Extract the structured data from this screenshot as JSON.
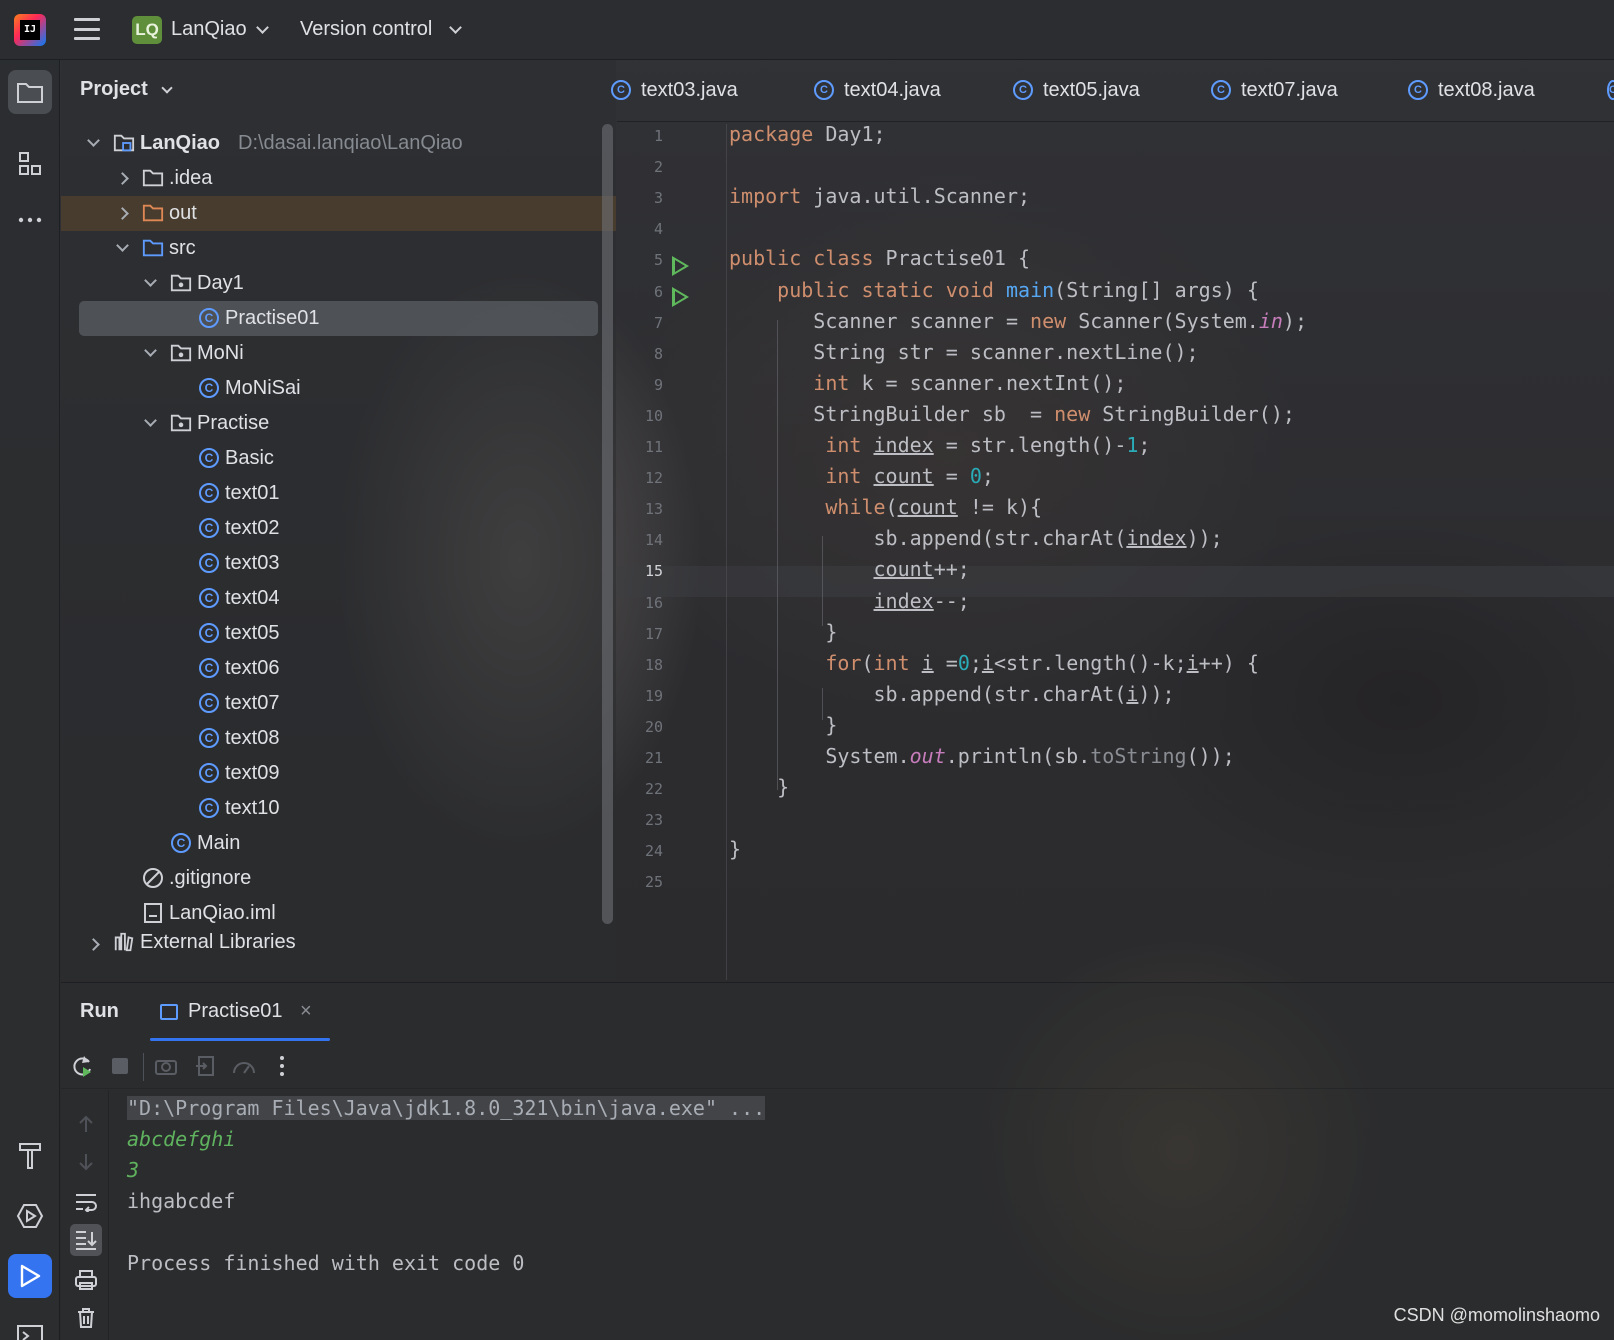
{
  "topbar": {
    "logo_text": "IJ",
    "project_badge": "LQ",
    "project_name": "LanQiao",
    "version_control": "Version control"
  },
  "project_panel": {
    "title": "Project",
    "tree": [
      {
        "label": "LanQiao",
        "path": "D:\\dasai.lanqiao\\LanQiao",
        "kind": "module",
        "depth": 0,
        "expanded": true
      },
      {
        "label": ".idea",
        "kind": "folder",
        "depth": 1,
        "expanded": false
      },
      {
        "label": "out",
        "kind": "folder-excluded",
        "depth": 1,
        "expanded": false
      },
      {
        "label": "src",
        "kind": "folder-source",
        "depth": 1,
        "expanded": true
      },
      {
        "label": "Day1",
        "kind": "package",
        "depth": 2,
        "expanded": true
      },
      {
        "label": "Practise01",
        "kind": "class",
        "depth": 3,
        "selected": true
      },
      {
        "label": "MoNi",
        "kind": "package",
        "depth": 2,
        "expanded": true
      },
      {
        "label": "MoNiSai",
        "kind": "class",
        "depth": 3
      },
      {
        "label": "Practise",
        "kind": "package",
        "depth": 2,
        "expanded": true
      },
      {
        "label": "Basic",
        "kind": "class",
        "depth": 3
      },
      {
        "label": "text01",
        "kind": "class",
        "depth": 3
      },
      {
        "label": "text02",
        "kind": "class",
        "depth": 3
      },
      {
        "label": "text03",
        "kind": "class",
        "depth": 3
      },
      {
        "label": "text04",
        "kind": "class",
        "depth": 3
      },
      {
        "label": "text05",
        "kind": "class",
        "depth": 3
      },
      {
        "label": "text06",
        "kind": "class",
        "depth": 3
      },
      {
        "label": "text07",
        "kind": "class",
        "depth": 3
      },
      {
        "label": "text08",
        "kind": "class",
        "depth": 3
      },
      {
        "label": "text09",
        "kind": "class",
        "depth": 3
      },
      {
        "label": "text10",
        "kind": "class",
        "depth": 3
      },
      {
        "label": "Main",
        "kind": "class",
        "depth": 2
      },
      {
        "label": ".gitignore",
        "kind": "ignore-file",
        "depth": 1
      },
      {
        "label": "LanQiao.iml",
        "kind": "iml-file",
        "depth": 1
      },
      {
        "label": "External Libraries",
        "kind": "libraries",
        "depth": 0,
        "expanded": false
      }
    ]
  },
  "editor": {
    "tabs": [
      "text03.java",
      "text04.java",
      "text05.java",
      "text07.java",
      "text08.java"
    ],
    "current_line": "15",
    "line_numbers": [
      "1",
      "2",
      "3",
      "4",
      "5",
      "6",
      "7",
      "8",
      "9",
      "10",
      "11",
      "12",
      "13",
      "14",
      "15",
      "16",
      "17",
      "18",
      "19",
      "20",
      "21",
      "22",
      "23",
      "24",
      "25"
    ],
    "code_lines": [
      "package Day1;",
      "",
      "import java.util.Scanner;",
      "",
      "public class Practise01 {",
      "    public static void main(String[] args) {",
      "       Scanner scanner = new Scanner(System.in);",
      "       String str = scanner.nextLine();",
      "       int k = scanner.nextInt();",
      "       StringBuilder sb  = new StringBuilder();",
      "        int index = str.length()-1;",
      "        int count = 0;",
      "        while(count != k){",
      "            sb.append(str.charAt(index));",
      "            count++;",
      "            index--;",
      "        }",
      "        for(int i =0;i<str.length()-k;i++) {",
      "            sb.append(str.charAt(i));",
      "        }",
      "        System.out.println(sb.toString());",
      "    }",
      "",
      "}",
      ""
    ]
  },
  "run_panel": {
    "title": "Run",
    "tab_label": "Practise01",
    "close_glyph": "×",
    "output": [
      {
        "text": "\"D:\\Program Files\\Java\\jdk1.8.0_321\\bin\\java.exe\" ...",
        "style": "cmd"
      },
      {
        "text": "abcdefghi",
        "style": "inp"
      },
      {
        "text": "3",
        "style": "inp"
      },
      {
        "text": "ihgabcdef",
        "style": "norm"
      },
      {
        "text": "",
        "style": "norm"
      },
      {
        "text": "Process finished with exit code 0",
        "style": "norm"
      }
    ]
  },
  "watermark": "CSDN @momolinshaomo",
  "colors": {
    "accent": "#3574f0",
    "keyword": "#cf8e6d",
    "method": "#56a8f5",
    "number": "#2aacb8",
    "static_field": "#c77dbb",
    "run_green": "#5fb85c",
    "class_icon": "#5e9bff"
  },
  "icons": {
    "strip_top": [
      "folder-icon",
      "structure-icon",
      "more-icon"
    ],
    "strip_bottom": [
      "build-icon",
      "services-icon",
      "run-icon",
      "terminal-icon"
    ],
    "run_toolbar": [
      "rerun-icon",
      "stop-icon",
      "screenshot-icon",
      "export-icon",
      "profiler-icon",
      "more-vertical-icon"
    ],
    "run_side": [
      "up-arrow-icon",
      "down-arrow-icon",
      "soft-wrap-icon",
      "scroll-to-end-icon",
      "print-icon",
      "trash-icon"
    ]
  }
}
